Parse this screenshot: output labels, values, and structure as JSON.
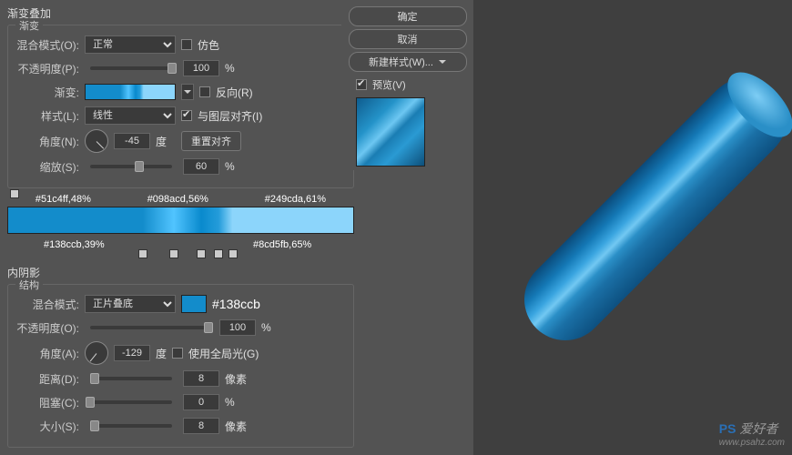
{
  "title": "渐变叠加",
  "gradient_section": {
    "legend": "渐变",
    "blend_mode": {
      "label": "混合模式(O):",
      "value": "正常",
      "dither_label": "仿色"
    },
    "opacity": {
      "label": "不透明度(P):",
      "value": "100",
      "unit": "%"
    },
    "gradient": {
      "label": "渐变:",
      "reverse_label": "反向(R)"
    },
    "style": {
      "label": "样式(L):",
      "value": "线性",
      "align_label": "与图层对齐(I)"
    },
    "angle": {
      "label": "角度(N):",
      "value": "-45",
      "unit": "度",
      "reset_btn": "重置对齐"
    },
    "scale": {
      "label": "缩放(S):",
      "value": "60",
      "unit": "%"
    }
  },
  "stops_top": [
    "#51c4ff,48%",
    "#098acd,56%",
    "#249cda,61%"
  ],
  "stops_bottom": {
    "left": "#138ccb,39%",
    "right": "#8cd5fb,65%"
  },
  "inner_shadow": {
    "title": "内阴影",
    "legend": "结构",
    "blend_mode": {
      "label": "混合模式:",
      "value": "正片叠底",
      "color": "#138ccb",
      "hex_text": "#138ccb"
    },
    "opacity": {
      "label": "不透明度(O):",
      "value": "100",
      "unit": "%"
    },
    "angle": {
      "label": "角度(A):",
      "value": "-129",
      "unit": "度",
      "global_label": "使用全局光(G)"
    },
    "distance": {
      "label": "距离(D):",
      "value": "8",
      "unit": "像素"
    },
    "choke": {
      "label": "阻塞(C):",
      "value": "0",
      "unit": "%"
    },
    "size": {
      "label": "大小(S):",
      "value": "8",
      "unit": "像素"
    }
  },
  "buttons": {
    "ok": "确定",
    "cancel": "取消",
    "new_style": "新建样式(W)...",
    "preview": "预览(V)"
  },
  "watermark": {
    "prefix": "PS",
    "text": " 爱好者",
    "url": "www.psahz.com"
  }
}
